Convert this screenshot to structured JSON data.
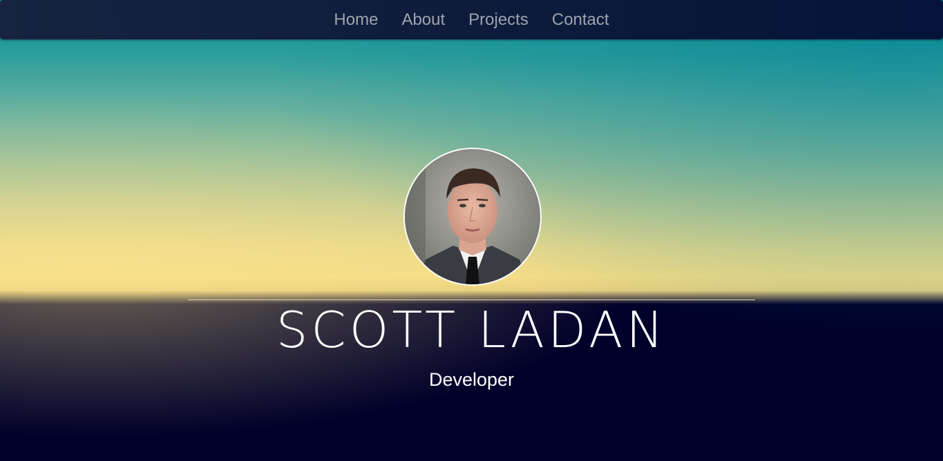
{
  "nav": {
    "items": [
      {
        "label": "Home"
      },
      {
        "label": "About"
      },
      {
        "label": "Projects"
      },
      {
        "label": "Contact"
      }
    ]
  },
  "hero": {
    "name": "SCOTT LADAN",
    "role": "Developer"
  },
  "colors": {
    "navbar": "#0e1b3b",
    "nav_text": "#9ea4ae",
    "sky_top": "#0d8f98",
    "sky_horizon": "#f4dc86",
    "ground": "#00002a",
    "text": "#ffffff"
  }
}
